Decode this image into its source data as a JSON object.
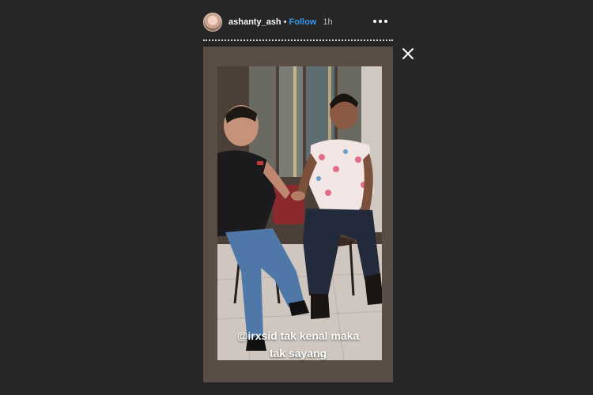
{
  "header": {
    "username": "ashanty_ash",
    "separator": "•",
    "follow_label": "Follow",
    "time_ago": "1h",
    "avatar_icon": "avatar",
    "more_icon": "more-options-icon"
  },
  "controls": {
    "close_icon": "close-icon"
  },
  "story": {
    "progress_fraction": 0.0,
    "caption_line1": "@irxsid tak kenal maka",
    "caption_line2": "tak sayang"
  },
  "colors": {
    "background": "#262626",
    "follow_link": "#3897f0",
    "text": "#fafafa"
  }
}
